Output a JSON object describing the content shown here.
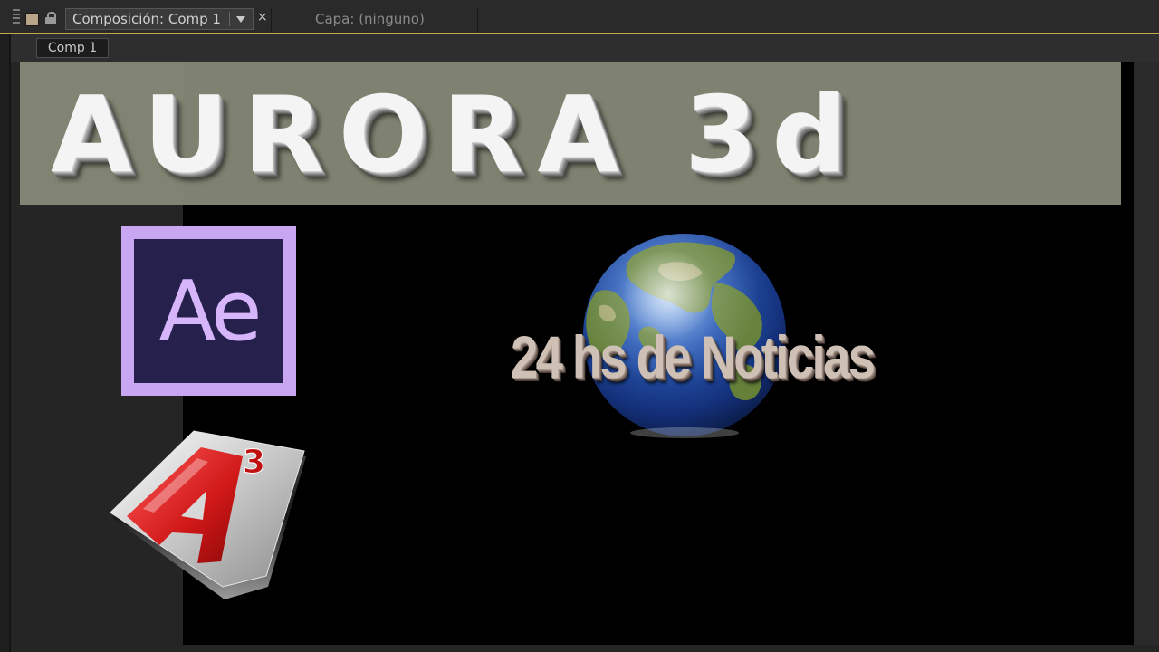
{
  "window": {
    "composition_tab_label": "Composición: Comp 1",
    "layer_tab_label": "Capa: (ninguno)",
    "close_glyph": "×"
  },
  "breadcrumb": {
    "comp_label": "Comp 1"
  },
  "banner": {
    "title": "AURORA 3d"
  },
  "logos": {
    "ae_text": "Ae",
    "a3_superscript": "3"
  },
  "viewer": {
    "globe_caption": "24 hs de Noticias"
  },
  "colors": {
    "tab_accent": "#c8a64a",
    "ae_border": "#c9a6f2",
    "ae_background": "#26204c",
    "ae_letters": "#d6b5fb",
    "banner_background": "#8a8c7a",
    "a3_red": "#e02020",
    "globe_ocean": "#1c3d8a",
    "globe_land": "#5b7a2a"
  },
  "icons": [
    "panel-grip-icon",
    "label-color-swatch",
    "lock-icon",
    "dropdown-arrow-icon",
    "close-icon",
    "ae-logo",
    "a3-logo",
    "globe-icon"
  ]
}
